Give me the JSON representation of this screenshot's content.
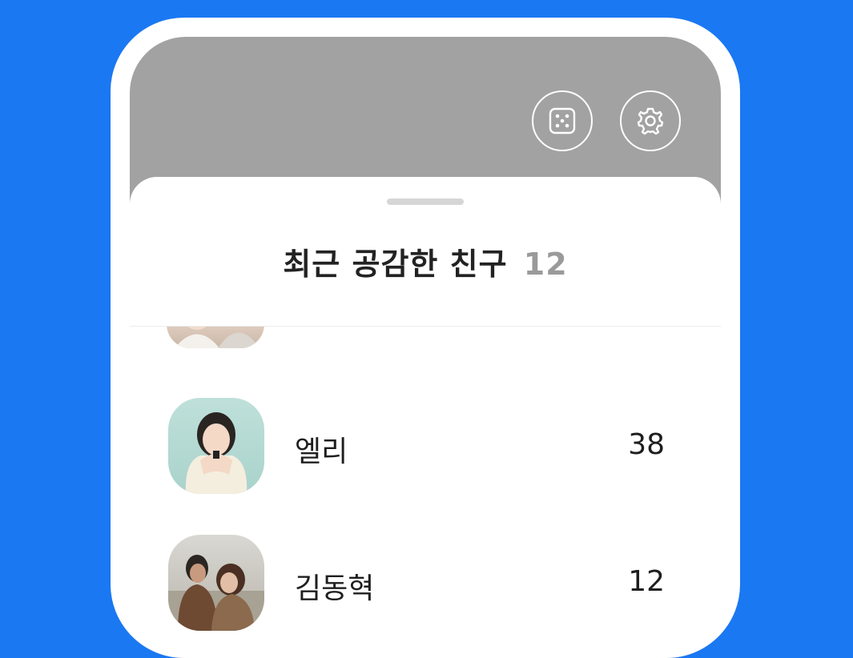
{
  "header": {
    "buttons": [
      {
        "icon": "dice-icon"
      },
      {
        "icon": "gear-icon"
      }
    ]
  },
  "sheet": {
    "title": "최근 공감한 친구",
    "count": "12"
  },
  "friends": [
    {
      "name": "엘리",
      "count": "38"
    },
    {
      "name": "김동혁",
      "count": "12"
    }
  ],
  "colors": {
    "background": "#1a78f2",
    "header_gray": "#a2a2a2",
    "count_gray": "#9a9a9a"
  }
}
